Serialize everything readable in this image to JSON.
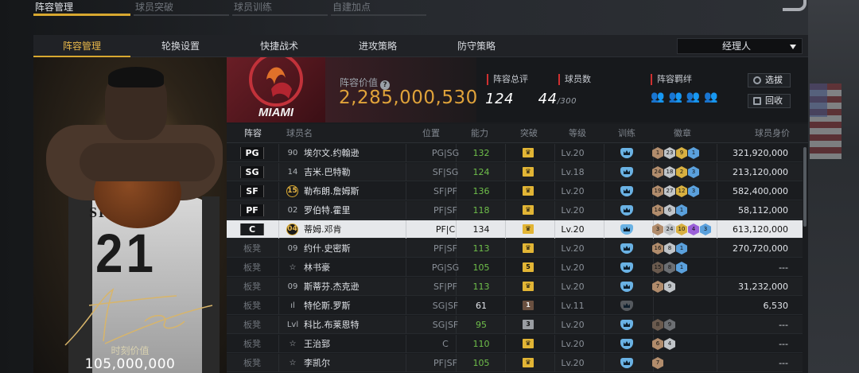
{
  "top_tabs": [
    {
      "label": "阵容管理",
      "active": true
    },
    {
      "label": "球员突破"
    },
    {
      "label": "球员训练"
    },
    {
      "label": "自建加点"
    }
  ],
  "sub_tabs": [
    "阵容管理",
    "轮换设置",
    "快捷战术",
    "进攻策略",
    "防守策略"
  ],
  "manager_select": {
    "value": "经理人"
  },
  "featured_player": {
    "jersey_number": "21",
    "jersey_text": "SPURS",
    "value_label": "时刻价值",
    "value": "105,000,000"
  },
  "team": {
    "logo_text": "MIAMI"
  },
  "summary": {
    "lineup_value_label": "阵容价值",
    "lineup_value": "2,285,000,530",
    "total_rating_label": "阵容总评",
    "total_rating": "124",
    "player_count_label": "球员数",
    "player_count": "44",
    "player_count_max": "/300",
    "chemistry_label": "阵容羁绊"
  },
  "buttons": {
    "select": "选拔",
    "recycle": "回收"
  },
  "columns": [
    "阵容",
    "球员名",
    "位置",
    "能力",
    "突破",
    "等级",
    "训练",
    "徽章",
    "球员身价"
  ],
  "rows": [
    {
      "slot": "PG",
      "num": "90",
      "name": "埃尔文.约翰逊",
      "pos": "PG|SG",
      "rating": "132",
      "brk": "♛",
      "lv": "Lv.20",
      "badges": [
        [
          "br",
          "1"
        ],
        [
          "sv",
          "23"
        ],
        [
          "gd",
          "9"
        ],
        [
          "bl",
          "1"
        ]
      ],
      "value": "321,920,000"
    },
    {
      "slot": "SG",
      "num": "14",
      "name": "吉米.巴特勒",
      "pos": "SF|SG",
      "rating": "124",
      "brk": "♛",
      "lv": "Lv.18",
      "badges": [
        [
          "br",
          "24"
        ],
        [
          "sv",
          "18"
        ],
        [
          "gd",
          "2"
        ],
        [
          "bl",
          "3"
        ]
      ],
      "value": "213,120,000"
    },
    {
      "slot": "SF",
      "num": "15",
      "num_style": "badge",
      "name": "勒布朗.詹姆斯",
      "pos": "SF|PF",
      "rating": "136",
      "brk": "♛",
      "lv": "Lv.20",
      "badges": [
        [
          "br",
          "19"
        ],
        [
          "sv",
          "27"
        ],
        [
          "gd",
          "12"
        ],
        [
          "bl",
          "3"
        ]
      ],
      "value": "582,400,000"
    },
    {
      "slot": "PF",
      "num": "02",
      "name": "罗伯特.霍里",
      "pos": "PF|SF",
      "rating": "118",
      "brk": "♛",
      "lv": "Lv.20",
      "badges": [
        [
          "br",
          "14"
        ],
        [
          "sv",
          "6"
        ],
        [
          "bl",
          "1"
        ]
      ],
      "value": "58,112,000"
    },
    {
      "slot": "C",
      "num": "04",
      "num_style": "badge",
      "name": "蒂姆.邓肯",
      "pos": "PF|C",
      "rating": "134",
      "brk": "♛",
      "lv": "Lv.20",
      "selected": true,
      "badges": [
        [
          "br",
          "3"
        ],
        [
          "sv",
          "24"
        ],
        [
          "gd",
          "10"
        ],
        [
          "pp",
          "4"
        ],
        [
          "bl",
          "3"
        ]
      ],
      "value": "613,120,000"
    },
    {
      "slot": "板凳",
      "num": "09",
      "name": "约什.史密斯",
      "pos": "PF|SF",
      "rating": "113",
      "brk": "♛",
      "lv": "Lv.20",
      "badges": [
        [
          "br",
          "16"
        ],
        [
          "sv",
          "8"
        ],
        [
          "bl",
          "1"
        ]
      ],
      "value": "270,720,000"
    },
    {
      "slot": "板凳",
      "num": "☆",
      "name": "林书豪",
      "pos": "PG|SG",
      "rating": "105",
      "brk": "5",
      "lv": "Lv.20",
      "badges": [
        [
          "dk",
          "15"
        ],
        [
          "dg",
          "8"
        ],
        [
          "bl",
          "1"
        ]
      ],
      "value": "---"
    },
    {
      "slot": "板凳",
      "num": "09",
      "name": "斯蒂芬.杰克逊",
      "pos": "SF|PF",
      "rating": "113",
      "brk": "♛",
      "lv": "Lv.20",
      "badges": [
        [
          "br",
          "7"
        ],
        [
          "sv",
          "9"
        ]
      ],
      "value": "31,232,000"
    },
    {
      "slot": "板凳",
      "num": "ıl",
      "name": "特伦斯.罗斯",
      "pos": "SG|SF",
      "rating": "61",
      "rating_white": true,
      "brk": "1",
      "brk_style": "dark",
      "lv": "Lv.11",
      "trainer_gray": true,
      "badges": [],
      "value": "6,530"
    },
    {
      "slot": "板凳",
      "num": "Lvl",
      "name": "科比.布莱恩特",
      "pos": "SG|SF",
      "rating": "95",
      "brk": "3",
      "brk_style": "gray",
      "lv": "Lv.20",
      "badges": [
        [
          "dk",
          "8"
        ],
        [
          "dg",
          "9"
        ]
      ],
      "value": "---"
    },
    {
      "slot": "板凳",
      "num": "☆",
      "name": "王治郅",
      "pos": "C",
      "rating": "110",
      "brk": "♛",
      "lv": "Lv.20",
      "badges": [
        [
          "br",
          "6"
        ],
        [
          "sv",
          "4"
        ]
      ],
      "value": "---"
    },
    {
      "slot": "板凳",
      "num": "☆",
      "name": "李凯尔",
      "pos": "PF|SF",
      "rating": "105",
      "brk": "♛",
      "lv": "Lv.20",
      "badges": [
        [
          "br",
          "7"
        ]
      ],
      "value": "---"
    }
  ],
  "colors": {
    "accent": "#d8a830",
    "lineup_value": "#e0a33a",
    "rating_green": "#6fbf4a",
    "trainer": "#6ab2e4"
  }
}
